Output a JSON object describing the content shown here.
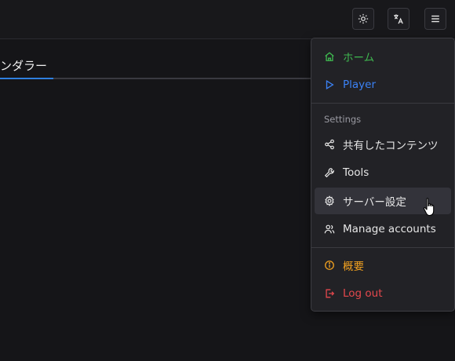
{
  "tab": {
    "label": "ンダラー"
  },
  "menu": {
    "section_label": "Settings",
    "items": [
      {
        "label": "ホーム",
        "icon": "home-icon",
        "color": "#3fb950"
      },
      {
        "label": "Player",
        "icon": "play-icon",
        "color": "#3b82f6"
      },
      {
        "label": "共有したコンテンツ",
        "icon": "share-icon",
        "color": "#e6e6e6"
      },
      {
        "label": "Tools",
        "icon": "wrench-icon",
        "color": "#e6e6e6"
      },
      {
        "label": "サーバー設定",
        "icon": "gear-icon",
        "color": "#e6e6e6"
      },
      {
        "label": "Manage accounts",
        "icon": "users-icon",
        "color": "#e6e6e6"
      },
      {
        "label": "概要",
        "icon": "info-icon",
        "color": "#f0a020"
      },
      {
        "label": "Log out",
        "icon": "logout-icon",
        "color": "#e5484d"
      }
    ]
  }
}
